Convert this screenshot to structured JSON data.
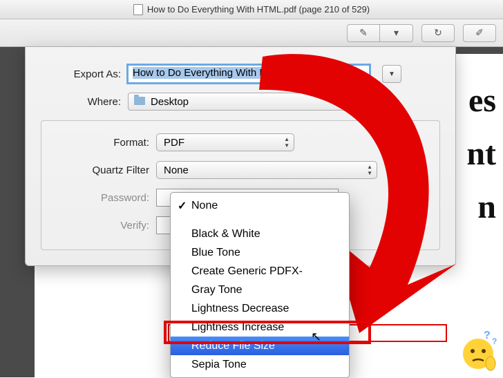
{
  "titlebar": {
    "title": "How to Do Everything With HTML.pdf (page 210 of 529)"
  },
  "sheet": {
    "export_label": "Export As:",
    "export_value": "How to Do Everything With HTML",
    "where_label": "Where:",
    "where_value": "Desktop",
    "format_label": "Format:",
    "format_value": "PDF",
    "filter_label": "Quartz Filter",
    "filter_value": "None",
    "password_label": "Password:",
    "verify_label": "Verify:"
  },
  "menu": {
    "items": [
      {
        "label": "None",
        "checked": true
      },
      {
        "label": "Black & White"
      },
      {
        "label": "Blue Tone"
      },
      {
        "label": "Create Generic PDFX-"
      },
      {
        "label": "Gray Tone"
      },
      {
        "label": "Lightness Decrease"
      },
      {
        "label": "Lightness Increase"
      },
      {
        "label": "Reduce File Size",
        "highlighted": true
      },
      {
        "label": "Sepia Tone"
      }
    ]
  },
  "background_text": {
    "line1": "es",
    "line2": "nt",
    "line3": "n"
  },
  "colors": {
    "highlight_red": "#e30202",
    "menu_highlight": "#2a5ee0",
    "selection_blue": "#a7c8ec"
  }
}
